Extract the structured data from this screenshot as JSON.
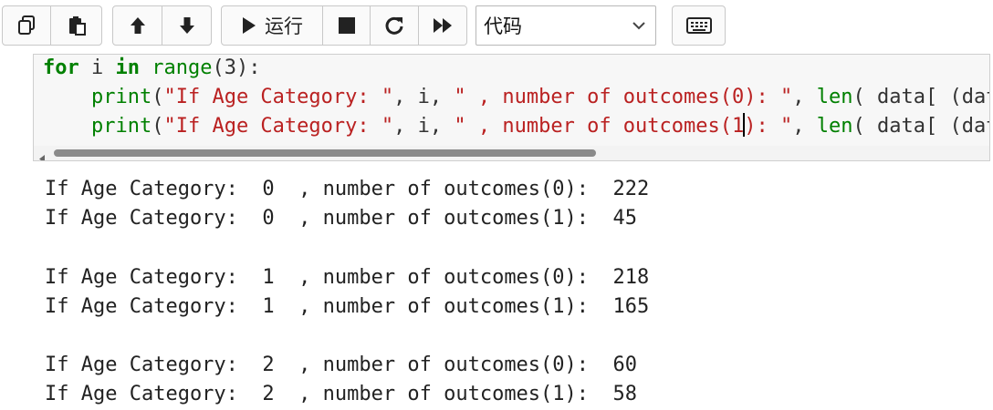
{
  "toolbar": {
    "copy_icon": "copy-icon",
    "paste_icon": "paste-icon",
    "move_up_icon": "arrow-up-icon",
    "move_down_icon": "arrow-down-icon",
    "run_label": "运行",
    "stop_icon": "stop-icon",
    "restart_icon": "restart-icon",
    "fast_forward_icon": "fast-forward-icon",
    "cell_type": "代码",
    "keyboard_icon": "keyboard-icon"
  },
  "cell": {
    "line1_kw_for": "for",
    "line1_var": " i ",
    "line1_kw_in": "in",
    "line1_sp": " ",
    "line1_range": "range",
    "line1_rest": "(3):",
    "line2_indent": "    ",
    "line2_print": "print",
    "line2_open": "(",
    "line2_str1": "\"If Age Category: \"",
    "line2_mid1": ", i, ",
    "line2_str2": "\" , number of outcomes(0): \"",
    "line2_mid2": ", ",
    "line2_len": "len",
    "line2_tail": "( data[ (dat",
    "line3_indent": "    ",
    "line3_print": "print",
    "line3_open": "(",
    "line3_str1": "\"If Age Category: \"",
    "line3_mid1": ", i, ",
    "line3_str2a": "\" , number of outcomes(1",
    "line3_str2b": "): \"",
    "line3_mid2": ", ",
    "line3_len": "len",
    "line3_tail": "( data[ (dat"
  },
  "output": {
    "lines": [
      "If Age Category:  0  , number of outcomes(0):  222",
      "If Age Category:  0  , number of outcomes(1):  45",
      "",
      "If Age Category:  1  , number of outcomes(0):  218",
      "If Age Category:  1  , number of outcomes(1):  165",
      "",
      "If Age Category:  2  , number of outcomes(0):  60",
      "If Age Category:  2  , number of outcomes(1):  58"
    ]
  },
  "colors": {
    "keyword": "#008000",
    "string": "#ba2121",
    "cell_background": "#f7f7f7"
  }
}
